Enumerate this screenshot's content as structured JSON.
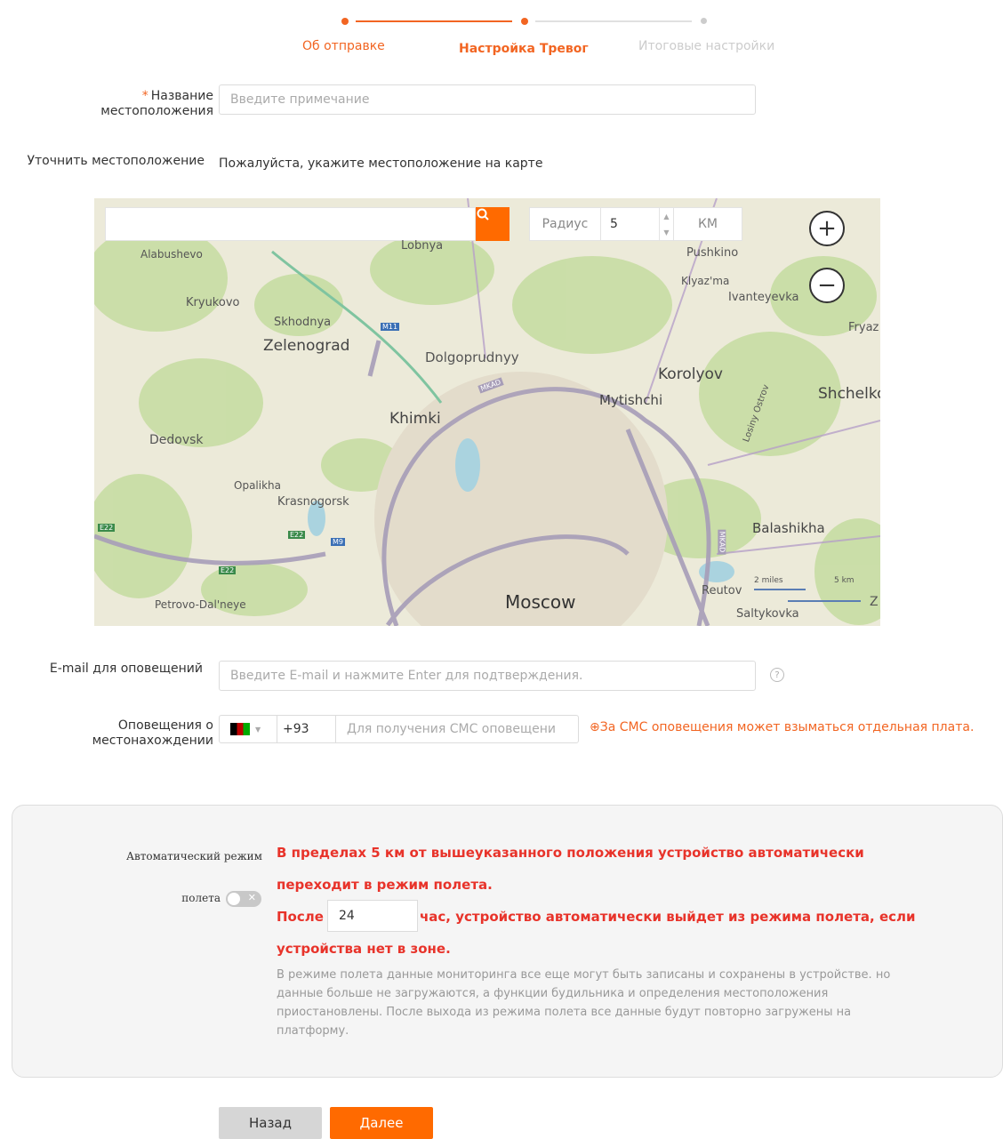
{
  "stepper": {
    "steps": [
      {
        "label": "Об отправке",
        "state": "done"
      },
      {
        "label": "Настройка Тревог",
        "state": "active"
      },
      {
        "label": "Итоговые настройки",
        "state": "pending"
      }
    ],
    "accent_color": "#f26522"
  },
  "form": {
    "location_name": {
      "label_line1": "Название",
      "label_line2": "местоположения",
      "required_mark": "*",
      "placeholder": "Введите примечание"
    },
    "refine_location": {
      "label": "Уточнить местоположение",
      "hint": "Пожалуйста, укажите местоположение на карте"
    },
    "email": {
      "label": "E-mail для оповещений",
      "placeholder": "Введите E-mail и нажмите Enter для подтверждения.",
      "help_icon": "question-circle-icon"
    },
    "sms": {
      "label_line1": "Оповещения о",
      "label_line2": "местонахождении",
      "country_code": "+93",
      "placeholder": "Для получения СМС оповещени",
      "note": "⊕За СМС оповещения может взыматься отдельная плата."
    }
  },
  "map": {
    "search_icon": "search-icon",
    "radius_label": "Радиус",
    "radius_value": "5",
    "radius_unit": "КМ",
    "zoom_in": "+",
    "zoom_out": "−",
    "places": [
      "Lobnya",
      "Pushkino",
      "Alabushevo",
      "Klyaz'ma",
      "Ivanteyevka",
      "Kryukovo",
      "Skhodnya",
      "Zelenograd",
      "Fryaz",
      "Dolgoprudnyy",
      "Korolyov",
      "Shchelko",
      "Mytishchi",
      "Khimki",
      "Dedovsk",
      "Losiny Ostrov",
      "Opalikha",
      "Krasnogorsk",
      "Balashikha",
      "Reutov",
      "Moscow",
      "Petrovo-Dal'neye",
      "Saltykovka",
      "Z"
    ],
    "road_labels": [
      "M11",
      "MKAD",
      "M9",
      "E22",
      "E22",
      "E22",
      "MKAD"
    ],
    "scale": {
      "miles": "2 miles",
      "km": "5 km"
    }
  },
  "airplane": {
    "label_line1": "Автоматический режим",
    "label_line2": "полета",
    "toggle_on": false,
    "line1": "В пределах 5 км от вышеуказанного положения устройство автоматически",
    "line2": "переходит в режим полета.",
    "after_prefix": "После",
    "hours_value": "24",
    "after_suffix": "час, устройство автоматически выйдет из режима полета, если",
    "line4": "устройства нет в зоне.",
    "description": "В режиме полета данные мониторинга все еще могут быть записаны и сохранены в устройстве. но данные больше не загружаются, а функции будильника и определения местоположения приостановлены. После выхода из режима полета все данные будут повторно загружены на платформу."
  },
  "buttons": {
    "back": "Назад",
    "next": "Далее"
  }
}
